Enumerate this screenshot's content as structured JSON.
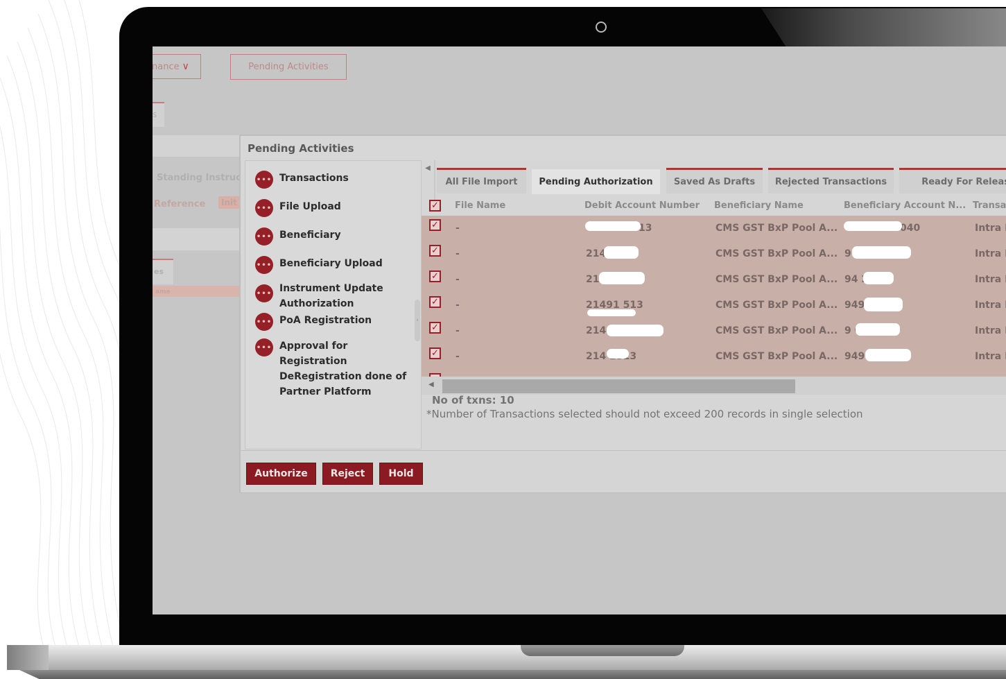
{
  "background_screen": {
    "dropdown_partial_label": "nance",
    "pending_activities_button": "Pending Activities",
    "tab_partial": "s",
    "standing_instruct_label": "Standing Instruct",
    "reference_label": "Reference",
    "init_pill": "Init",
    "es_tab_partial": "es",
    "row_partial": "ame"
  },
  "modal": {
    "title": "Pending Activities",
    "menu": [
      {
        "label": "Transactions",
        "icon": "chat-bubble-icon"
      },
      {
        "label": "File Upload",
        "icon": "chat-bubble-icon"
      },
      {
        "label": "Beneficiary",
        "icon": "chat-bubble-icon"
      },
      {
        "label": "Beneficiary Upload",
        "icon": "chat-bubble-icon"
      },
      {
        "label": "Instrument Update Authorization",
        "icon": "chat-bubble-icon"
      },
      {
        "label": "PoA Registration",
        "icon": "chat-bubble-icon"
      },
      {
        "label": "Approval for Registration DeRegistration done of Partner Platform",
        "icon": "chat-bubble-icon"
      }
    ],
    "tabs": [
      {
        "label": "All File Import",
        "active": false
      },
      {
        "label": "Pending Authorization",
        "active": true
      },
      {
        "label": "Saved As Drafts",
        "active": false
      },
      {
        "label": "Rejected Transactions",
        "active": false
      },
      {
        "label": "Ready For Release",
        "active": false
      }
    ],
    "columns": [
      "File Name",
      "Debit Account Number",
      "Beneficiary Name",
      "Beneficiary Account N...",
      "Transa"
    ],
    "rows": [
      {
        "file_name": "-",
        "debit_account": "13",
        "beneficiary_name": "CMS GST BxP Pool A...",
        "beneficiary_account": "040",
        "transaction_type": "Intra E"
      },
      {
        "file_name": "-",
        "debit_account": "214 513",
        "beneficiary_name": "CMS GST BxP Pool A...",
        "beneficiary_account": "9 0",
        "transaction_type": "Intra E"
      },
      {
        "file_name": "-",
        "debit_account": "21 3",
        "beneficiary_name": "CMS GST BxP Pool A...",
        "beneficiary_account": "94 2040",
        "transaction_type": "Intra E"
      },
      {
        "file_name": "-",
        "debit_account": "21491 513",
        "beneficiary_name": "CMS GST BxP Pool A...",
        "beneficiary_account": "949 040",
        "transaction_type": "Intra E"
      },
      {
        "file_name": "-",
        "debit_account": "214",
        "beneficiary_name": "CMS GST BxP Pool A...",
        "beneficiary_account": "9 040",
        "transaction_type": "Intra E"
      },
      {
        "file_name": "-",
        "debit_account": "214 2513",
        "beneficiary_name": "CMS GST BxP Pool A...",
        "beneficiary_account": "949",
        "transaction_type": "Intra E"
      }
    ],
    "txn_count": "No of txns: 10",
    "txn_note": "*Number of Transactions selected should not exceed 200 records in single selection",
    "buttons": {
      "authorize": "Authorize",
      "reject": "Reject",
      "hold": "Hold"
    }
  },
  "colors": {
    "brand_red": "#8b1a22",
    "row_highlight": "#c8b0a9",
    "laptop_bezel": "#050505"
  }
}
